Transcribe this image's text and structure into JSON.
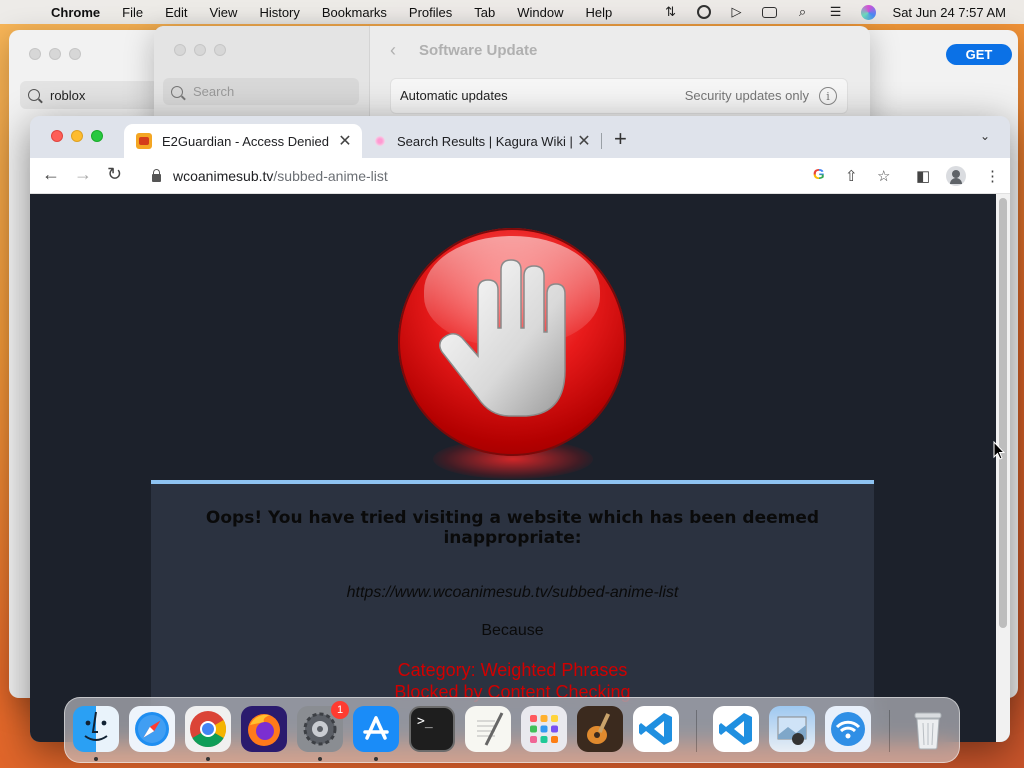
{
  "menubar": {
    "app_name": "Chrome",
    "items": [
      "File",
      "Edit",
      "View",
      "History",
      "Bookmarks",
      "Profiles",
      "Tab",
      "Window",
      "Help"
    ],
    "clock": "Sat Jun 24  7:57 AM",
    "status_icons": [
      "cellular-icon",
      "user-icon",
      "play-icon",
      "window-icon",
      "search-icon",
      "control-center-icon",
      "siri-icon"
    ]
  },
  "app_store_window": {
    "search_value": "roblox",
    "get_button": "GET"
  },
  "software_update_window": {
    "search_placeholder": "Search",
    "title": "Software Update",
    "row_label": "Automatic updates",
    "row_value": "Security updates only"
  },
  "chrome": {
    "tabs": [
      {
        "title": "E2Guardian - Access Denied",
        "active": true
      },
      {
        "title": "Search Results | Kagura Wiki | F",
        "active": false
      }
    ],
    "url_host": "wcoanimesub.tv",
    "url_path": "/subbed-anime-list"
  },
  "page": {
    "message": "Oops! You have tried visiting a website which has been deemed inappropriate:",
    "blocked_url": "https://www.wcoanimesub.tv/subbed-anime-list",
    "because": "Because",
    "category": "Category: Weighted Phrases",
    "blocked_by": "Blocked by Content Checking"
  },
  "dock": {
    "apps": [
      "Finder",
      "Safari",
      "Google Chrome",
      "Firefox",
      "System Settings",
      "App Store",
      "Terminal",
      "TextEdit",
      "Launchpad",
      "GarageBand",
      "Visual Studio Code",
      "Visual Studio Code",
      "Preview",
      "Wireless Diagnostics",
      "Trash"
    ],
    "system_settings_badge": "1"
  },
  "colors": {
    "accent_blue": "#0b71e6",
    "page_background": "#1c212b",
    "message_box": "#2b3240",
    "blocked_red": "#d10000"
  }
}
